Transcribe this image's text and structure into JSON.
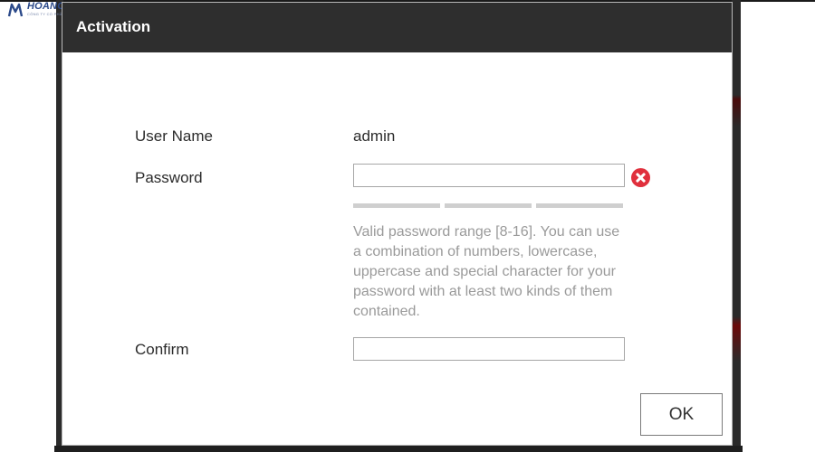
{
  "logo": {
    "name": "HOANG MINH",
    "tagline": "CÔNG TY CỔ PHẦN CÔNG NGHỆ"
  },
  "dialog": {
    "title": "Activation",
    "user_name": {
      "label": "User Name",
      "value": "admin"
    },
    "password": {
      "label": "Password",
      "value": "",
      "placeholder": "",
      "strength_segments": 3
    },
    "password_hint": "Valid password range [8-16]. You can use a combination of numbers, lowercase, uppercase and special character for your password with at least two kinds of them contained.",
    "confirm": {
      "label": "Confirm",
      "value": "",
      "placeholder": ""
    },
    "ok_label": "OK"
  },
  "colors": {
    "titlebar": "#2e2e2e",
    "error": "#e0303d",
    "hint_text": "#9a9a9a",
    "logo": "#2c4a8a"
  },
  "icons": {
    "error": "error-x-icon",
    "logo": "logo-mark-icon"
  }
}
